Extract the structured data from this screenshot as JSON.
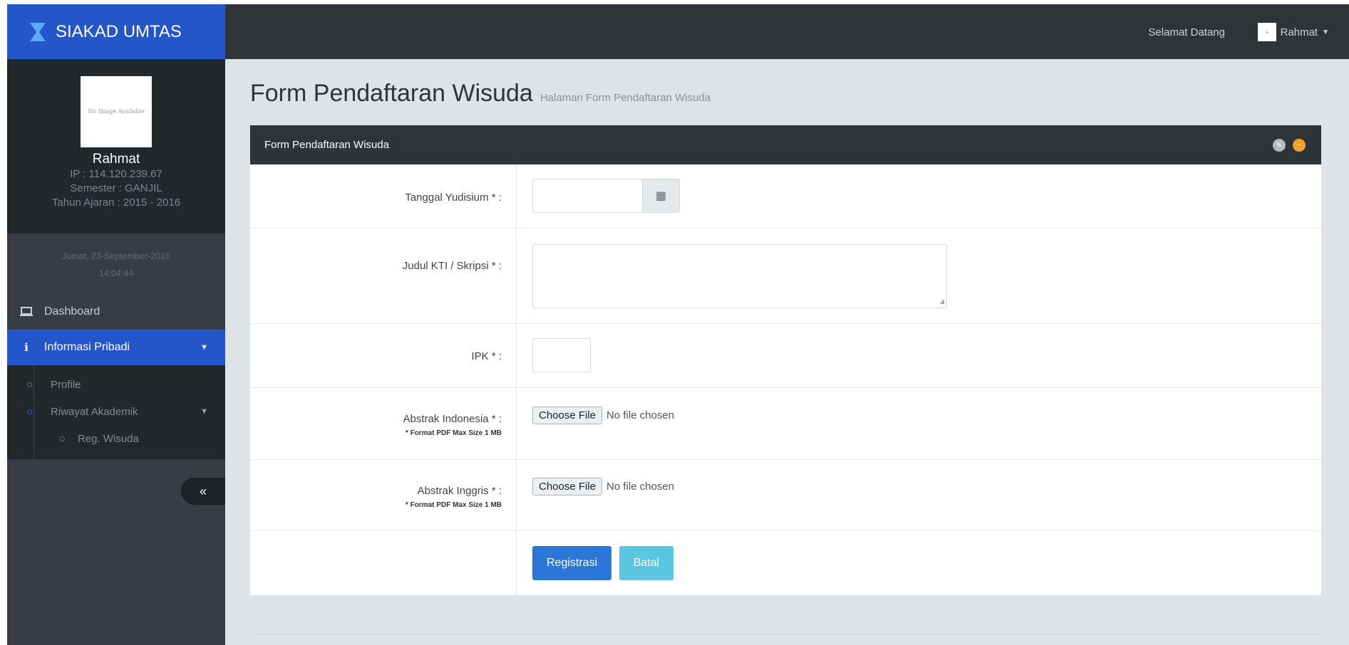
{
  "brand": {
    "title": "SIAKAD UMTAS"
  },
  "sidebar": {
    "avatar_text": "No Image Available",
    "user_name": "Rahmat",
    "ip": "IP : 114.120.239.67",
    "semester": "Semester : GANJIL",
    "tahun_ajaran": "Tahun Ajaran : 2015 - 2016",
    "date": "Jumat, 23-September-2016",
    "time": "14:04:44",
    "menu": [
      {
        "label": "Dashboard",
        "icon": "laptop-icon"
      },
      {
        "label": "Informasi Pribadi",
        "icon": "info-icon"
      }
    ],
    "submenu": [
      {
        "label": "Profile"
      },
      {
        "label": "Riwayat Akademik"
      }
    ],
    "subsubmenu": [
      {
        "label": "Reg. Wisuda"
      }
    ],
    "collapse_label": "«"
  },
  "topbar": {
    "welcome": "Selamat Datang",
    "user": "Rahmat",
    "avatar_text": "≡"
  },
  "page": {
    "title": "Form Pendaftaran Wisuda",
    "subtitle": "Halaman Form Pendaftaran Wisuda"
  },
  "panel": {
    "title": "Form Pendaftaran Wisuda"
  },
  "form": {
    "tanggal_label": "Tanggal Yudisium * :",
    "judul_label": "Judul KTI / Skripsi * :",
    "ipk_label": "IPK * :",
    "abstrak_id_label": "Abstrak Indonesia * :",
    "abstrak_en_label": "Abstrak Inggris * :",
    "file_note": "* Format PDF Max Size 1 MB",
    "choose_file": "Choose File",
    "no_file": "No file chosen",
    "submit": "Registrasi",
    "cancel": "Batal"
  },
  "icons": {
    "calendar": "▦",
    "caret_down": "▼",
    "edit": "✎",
    "minus": "−",
    "info": "ℹ",
    "laptop": "▭"
  },
  "colors": {
    "brand_blue": "#2357c9",
    "sidebar_dark": "#23282d",
    "topbar": "#2f3439",
    "primary_button": "#2a77d8",
    "info_button": "#5bc6e0",
    "tool_orange": "#f3a32c"
  }
}
